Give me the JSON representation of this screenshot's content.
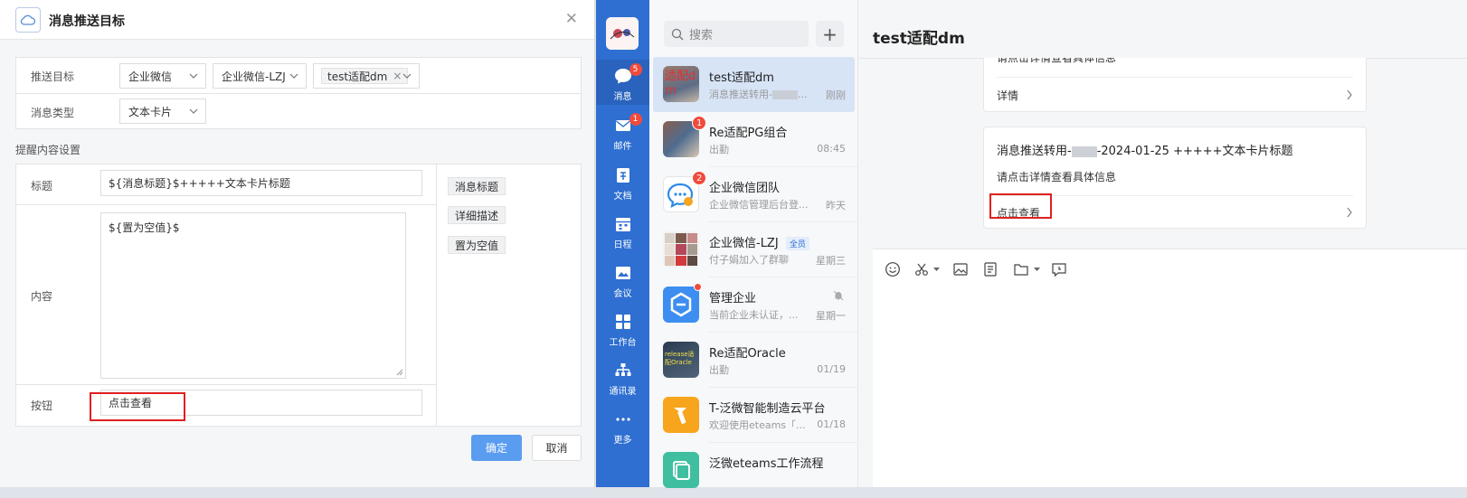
{
  "dialog": {
    "title": "消息推送目标",
    "target_label": "推送目标",
    "target_values": [
      "企业微信",
      "企业微信-LZJ"
    ],
    "target_tag": "test适配dm",
    "type_label": "消息类型",
    "type_value": "文本卡片",
    "section_title": "提醒内容设置",
    "title_field_label": "标题",
    "title_field_value": "${消息标题}$+++++文本卡片标题",
    "content_label": "内容",
    "content_value": "${置为空值}$",
    "button_label": "按钮",
    "button_value": "点击查看",
    "variables": [
      "消息标题",
      "详细描述",
      "置为空值"
    ],
    "ok": "确定",
    "cancel": "取消"
  },
  "rail": {
    "items": [
      {
        "label": "消息",
        "badge": "5"
      },
      {
        "label": "邮件",
        "badge": "1"
      },
      {
        "label": "文档"
      },
      {
        "label": "日程"
      },
      {
        "label": "会议"
      },
      {
        "label": "工作台"
      },
      {
        "label": "通讯录"
      },
      {
        "label": "更多"
      }
    ]
  },
  "list": {
    "search_placeholder": "搜索",
    "conversations": [
      {
        "name": "test适配dm",
        "preview": "消息推送转用-",
        "preview_tail": "...",
        "time": "刚刚"
      },
      {
        "name": "Re适配PG组合",
        "preview": "出勤",
        "time": "08:45",
        "badge": "1"
      },
      {
        "name": "企业微信团队",
        "preview": "企业微信管理后台登...",
        "time": "昨天",
        "badge": "2"
      },
      {
        "name": "企业微信-LZJ",
        "tag": "全员",
        "preview": "付子娟加入了群聊",
        "time": "星期三"
      },
      {
        "name": "管理企业",
        "preview": "当前企业未认证，...",
        "time": "星期一"
      },
      {
        "name": "Re适配Oracle",
        "preview": "出勤",
        "time": "01/19"
      },
      {
        "name": "T-泛微智能制造云平台",
        "preview": "欢迎使用eteams「...",
        "time": "01/18"
      },
      {
        "name": "泛微eteams工作流程",
        "preview": "",
        "time": ""
      }
    ],
    "avatar_texts": {
      "test": "适配dm",
      "oracle": "release适配Oracle"
    }
  },
  "chat": {
    "title": "test适配dm",
    "card1": {
      "desc": "请点击详情查看具体信息",
      "link": "详情"
    },
    "card2": {
      "title_prefix": "消息推送转用-",
      "title_suffix": "-2024-01-25 +++++文本卡片标题",
      "desc": "请点击详情查看具体信息",
      "link": "点击查看"
    }
  }
}
